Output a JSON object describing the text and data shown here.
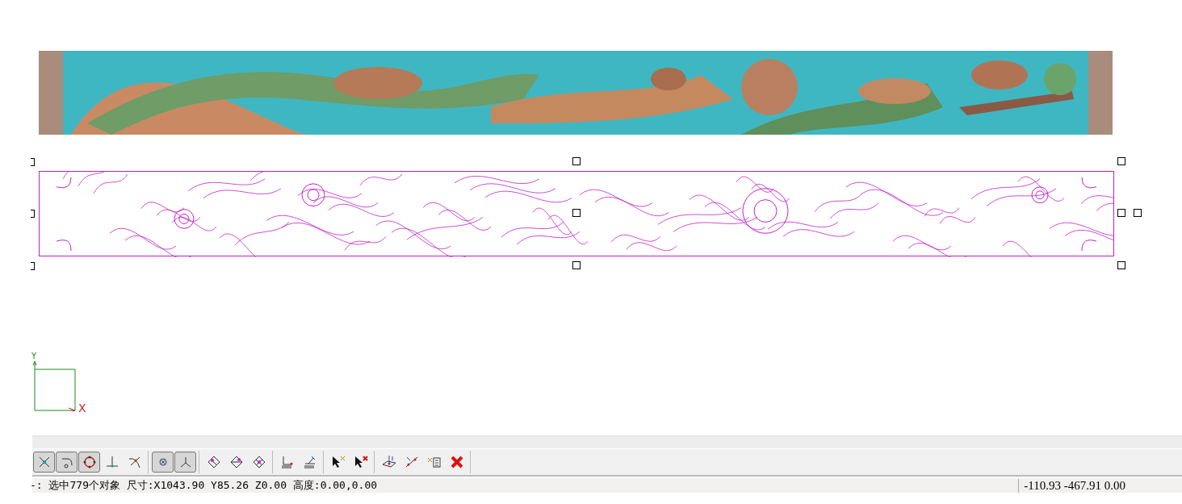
{
  "canvas": {
    "axes": {
      "x_label": "X",
      "y_label": "Y"
    }
  },
  "toolbar": {
    "groups": [
      [
        {
          "kind": "intersection",
          "pressed": true
        },
        {
          "kind": "arc",
          "pressed": true
        },
        {
          "kind": "circle-snap",
          "pressed": true
        },
        {
          "kind": "perpendicular",
          "pressed": false
        },
        {
          "kind": "tangent",
          "pressed": false
        }
      ],
      [
        {
          "kind": "point",
          "pressed": true
        },
        {
          "kind": "axes",
          "pressed": true
        }
      ],
      [
        {
          "kind": "diamond-a",
          "pressed": false
        },
        {
          "kind": "diamond-b",
          "pressed": false
        },
        {
          "kind": "diamond-c",
          "pressed": false
        }
      ],
      [
        {
          "kind": "layers-a",
          "pressed": false
        },
        {
          "kind": "layers-b",
          "pressed": false
        }
      ],
      [
        {
          "kind": "cursor-point",
          "pressed": false
        },
        {
          "kind": "cursor-delete",
          "pressed": false
        }
      ],
      [
        {
          "kind": "plane-point",
          "pressed": false
        },
        {
          "kind": "line-points",
          "pressed": false
        },
        {
          "kind": "list-point",
          "pressed": false
        },
        {
          "kind": "delete",
          "pressed": false
        }
      ]
    ]
  },
  "status_bar": {
    "selection": "-: 选中779个对象 尺寸:X1043.90 Y85.26 Z0.00 高度:0.00,0.00",
    "coordinates": "-110.93 -467.91 0.00"
  }
}
